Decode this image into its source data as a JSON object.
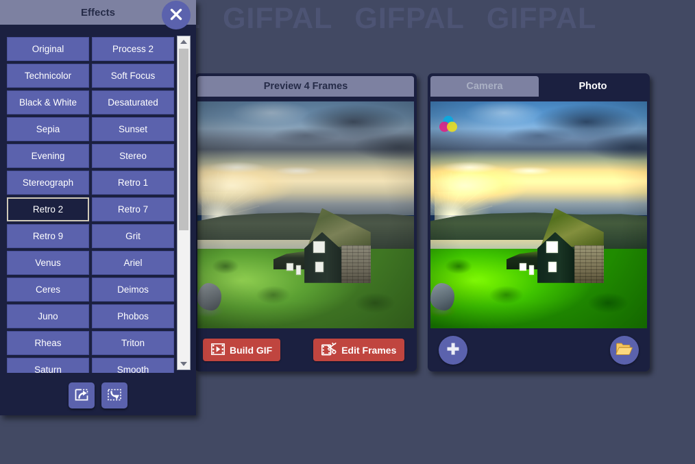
{
  "app": {
    "watermark": "GIFPAL",
    "watermark_repeat": 5,
    "background_color": "#424963"
  },
  "effects_dialog": {
    "title": "Effects",
    "close_icon": "close-x-icon",
    "selected_effect": "Retro 2",
    "effects": [
      "Original",
      "Process 2",
      "Technicolor",
      "Soft Focus",
      "Black & White",
      "Desaturated",
      "Sepia",
      "Sunset",
      "Evening",
      "Stereo",
      "Stereograph",
      "Retro 1",
      "Retro 2",
      "Retro 7",
      "Retro 9",
      "Grit",
      "Venus",
      "Ariel",
      "Ceres",
      "Deimos",
      "Juno",
      "Phobos",
      "Rheas",
      "Triton",
      "Saturn",
      "Smooth"
    ],
    "scrollbar": {
      "up_icon": "scroll-up-arrow-icon",
      "down_icon": "scroll-down-arrow-icon"
    },
    "footer_tools": [
      {
        "name": "apply-to-all-frames",
        "icon": "share-arrow-icon"
      },
      {
        "name": "apply-to-current-frame",
        "icon": "download-arrow-icon"
      }
    ]
  },
  "preview_panel": {
    "title": "Preview 4 Frames",
    "buttons": [
      {
        "label": "Build GIF",
        "icon": "film-play-icon",
        "color": "#c0453f"
      },
      {
        "label": "Edit Frames",
        "icon": "film-scissors-icon",
        "color": "#c0453f"
      }
    ]
  },
  "photo_panel": {
    "tabs": [
      {
        "label": "Camera",
        "active": false
      },
      {
        "label": "Photo",
        "active": true
      }
    ],
    "overlay_icon": "color-wheel-icon",
    "buttons": [
      {
        "name": "add-photo-button",
        "icon": "plus-icon"
      },
      {
        "name": "open-folder-button",
        "icon": "open-folder-icon"
      }
    ]
  }
}
